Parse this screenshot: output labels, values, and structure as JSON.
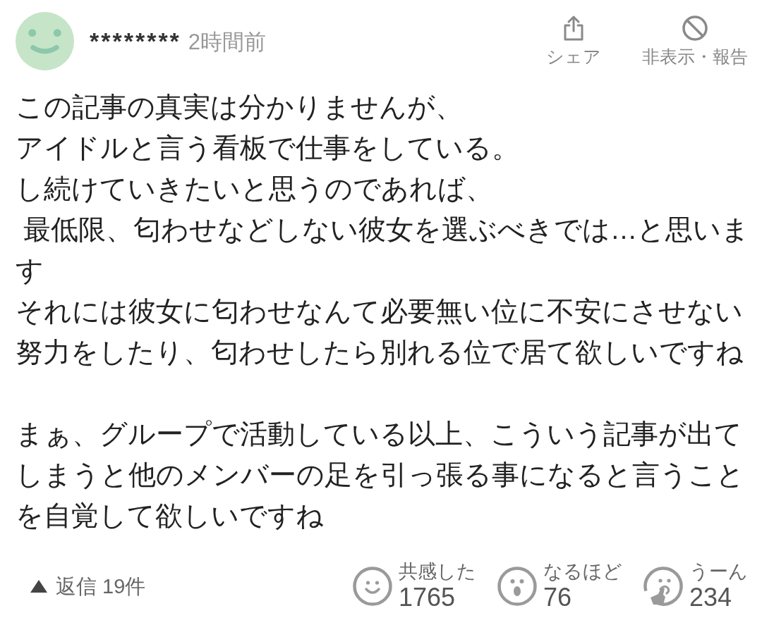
{
  "comment": {
    "user_name": "********",
    "posted": "2時間前"
  },
  "actions": [
    {
      "kind": "share",
      "label": "シェア"
    },
    {
      "kind": "hide",
      "label": "非表示・報告"
    }
  ],
  "paragraphs": [
    {
      "lines": [
        "この記事の真実は分かりませんが、",
        "アイドルと言う看板で仕事をしている。",
        "し続けていきたいと思うのであれば、",
        " 最低限、匂わせなどしない彼女を選ぶべきでは…と思います",
        "それには彼女に匂わせなんて必要無い位に不安にさせない努力をしたり、匂わせしたら別れる位で居て欲しいですね"
      ]
    },
    {
      "lines": [
        "まぁ、グループで活動している以上、こういう記事が出てしまうと他のメンバーの足を引っ張る事になると言うことを自覚して欲しいですね"
      ]
    }
  ],
  "replies": {
    "label": "返信 19件"
  },
  "reactions": [
    {
      "kind": "empathy",
      "label": "共感した",
      "count": "1765"
    },
    {
      "kind": "surprise",
      "label": "なるほど",
      "count": "76"
    },
    {
      "kind": "hmm",
      "label": "うーん",
      "count": "234"
    }
  ]
}
